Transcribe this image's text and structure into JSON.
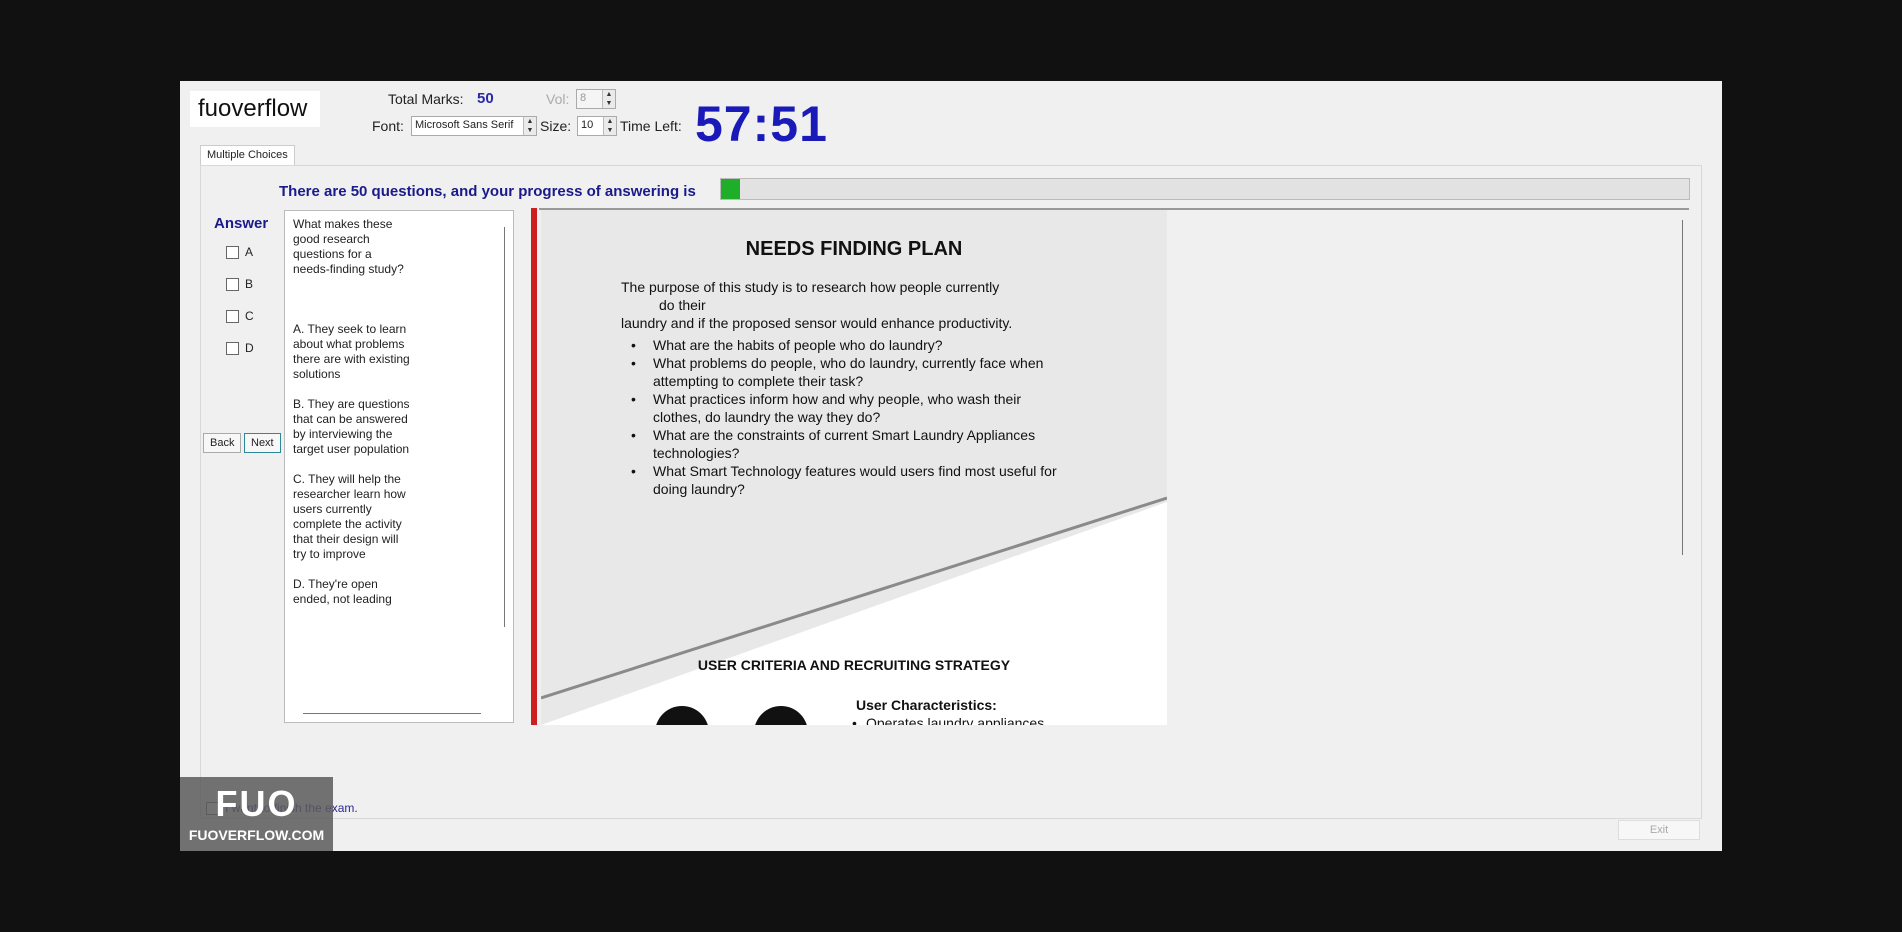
{
  "app": {
    "brand": "fuoverflow"
  },
  "header": {
    "total_marks_label": "Total Marks:",
    "total_marks_value": "50",
    "vol_label": "Vol:",
    "vol_value": "8",
    "font_label": "Font:",
    "font_value": "Microsoft Sans Serif",
    "size_label": "Size:",
    "size_value": "10",
    "time_left_label": "Time Left:",
    "time_left_value": "57:51"
  },
  "tabs": [
    {
      "label": "Multiple Choices"
    }
  ],
  "progress": {
    "text": "There are 50 questions, and your progress of answering is",
    "fraction": 0.02,
    "color": "#1fae2a"
  },
  "answer": {
    "title": "Answer",
    "options": [
      "A",
      "B",
      "C",
      "D"
    ]
  },
  "nav": {
    "back_label": "Back",
    "next_label": "Next"
  },
  "question": {
    "text": "What makes these good research questions for a needs-finding study?\n\n\n\nA.  They seek to learn about what problems there are with existing solutions\n\nB.  They are questions that can be answered by interviewing the target user population\n\nC.  They will help the researcher learn how users currently complete the activity that their design will try to improve\n\nD.  They're open ended, not leading"
  },
  "slide": {
    "title": "NEEDS FINDING PLAN",
    "purpose_line1": "The purpose of this study is to research how people currently",
    "purpose_line2": "do their",
    "purpose_line3": "laundry and if the proposed sensor would enhance productivity.",
    "bullets": [
      "What are the habits of people who do laundry?",
      "What problems do people, who do laundry, currently face when attempting to complete their task?",
      "What practices inform how and why people, who wash their clothes, do laundry the way they do?",
      "What are the constraints of current Smart Laundry Appliances technologies?",
      "What Smart Technology features would users find most useful for doing laundry?"
    ],
    "subtitle": "USER CRITERIA AND RECRUITING STRATEGY",
    "user_char_title": "User Characteristics:",
    "user_char_item": "Operates laundry appliances"
  },
  "footer": {
    "finish_label": "I want to finish the exam.",
    "exit_label": "Exit"
  },
  "watermark": {
    "big": "FUO",
    "small": "FUOVERFLOW.COM"
  }
}
